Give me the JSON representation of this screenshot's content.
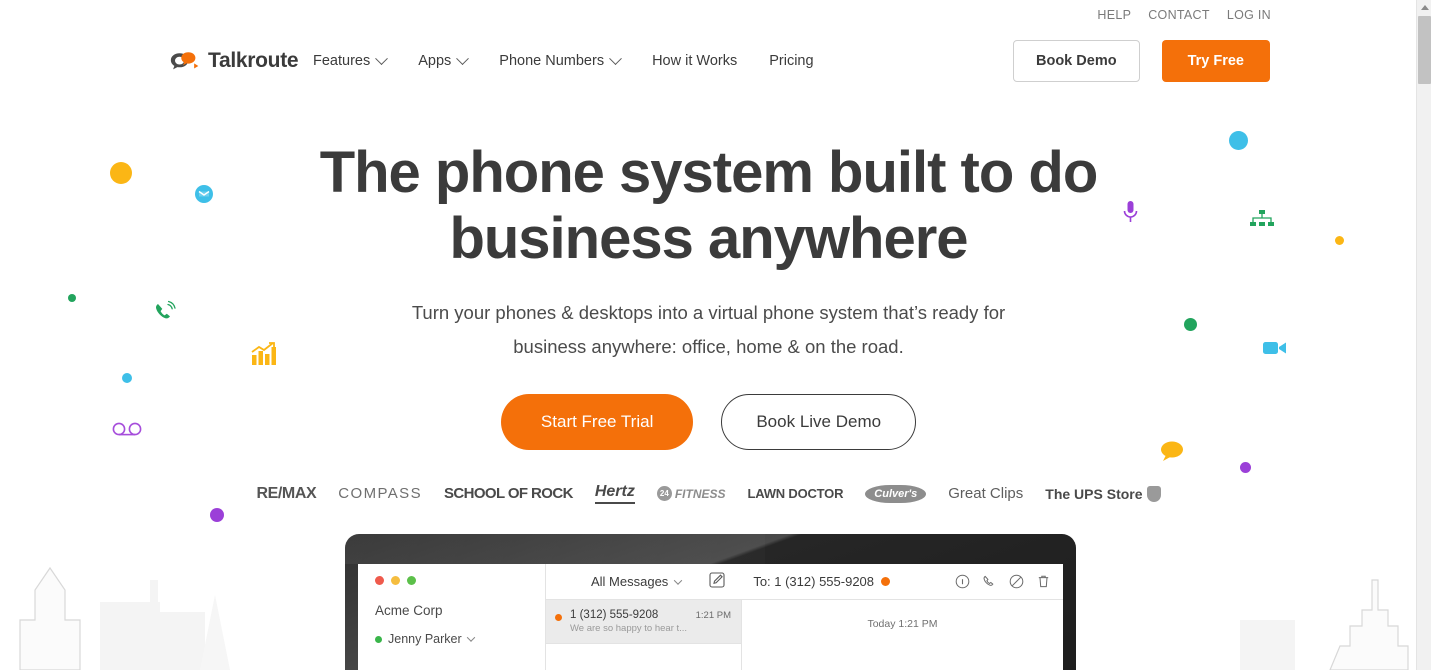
{
  "utility_nav": [
    {
      "label": "HELP"
    },
    {
      "label": "CONTACT"
    },
    {
      "label": "LOG IN"
    }
  ],
  "brand": {
    "name": "Talkroute",
    "logo_icon": "talkroute-logo-icon"
  },
  "nav": [
    {
      "label": "Features",
      "has_dropdown": true
    },
    {
      "label": "Apps",
      "has_dropdown": true
    },
    {
      "label": "Phone Numbers",
      "has_dropdown": true
    },
    {
      "label": "How it Works",
      "has_dropdown": false
    },
    {
      "label": "Pricing",
      "has_dropdown": false
    }
  ],
  "header_ctas": {
    "demo_label": "Book Demo",
    "try_label": "Try Free"
  },
  "hero": {
    "headline": "The phone system built to do business anywhere",
    "subhead": "Turn your phones & desktops into a virtual phone system that’s ready for business anywhere: office, home & on the road.",
    "primary_cta": "Start Free Trial",
    "secondary_cta": "Book Live Demo"
  },
  "client_logos": [
    {
      "name": "RE/MAX"
    },
    {
      "name": "COMPASS"
    },
    {
      "name": "SCHOOL OF ROCK"
    },
    {
      "name": "Hertz"
    },
    {
      "name": "FITNESS"
    },
    {
      "name": "LAWN DOCTOR"
    },
    {
      "name": "Culver's"
    },
    {
      "name": "Great Clips"
    },
    {
      "name": "The UPS Store"
    }
  ],
  "decorations": [
    {
      "icon": "yellow-dot-icon",
      "color": "#fbb615"
    },
    {
      "icon": "blue-envelope-icon",
      "color": "#3ebfe8"
    },
    {
      "icon": "green-dot-icon",
      "color": "#22a45d"
    },
    {
      "icon": "green-ringing-phone-icon",
      "color": "#22a45d"
    },
    {
      "icon": "orange-bar-chart-icon",
      "color": "#fbb615"
    },
    {
      "icon": "blue-dot-icon",
      "color": "#3ebfe8"
    },
    {
      "icon": "purple-voicemail-icon",
      "color": "#a64ddb"
    },
    {
      "icon": "purple-dot-icon",
      "color": "#9b3fd8"
    },
    {
      "icon": "blue-dot-icon",
      "color": "#3ebfe8"
    },
    {
      "icon": "purple-microphone-icon",
      "color": "#9b3fd8"
    },
    {
      "icon": "green-sitemap-icon",
      "color": "#22a45d"
    },
    {
      "icon": "yellow-dot-icon",
      "color": "#fbb615"
    },
    {
      "icon": "green-dot-icon",
      "color": "#22a45d"
    },
    {
      "icon": "blue-video-camera-icon",
      "color": "#3ebfe8"
    },
    {
      "icon": "yellow-chat-bubble-icon",
      "color": "#fbb615"
    },
    {
      "icon": "purple-dot-icon",
      "color": "#9b3fd8"
    }
  ],
  "app_mockup": {
    "sidebar": {
      "org_name": "Acme Corp",
      "user_name": "Jenny Parker"
    },
    "toolbar": {
      "filter_label": "All Messages",
      "compose_icon": "compose-pencil-icon",
      "to_label": "To: 1 (312) 555-9208",
      "icons": [
        {
          "name": "info-icon"
        },
        {
          "name": "phone-icon"
        },
        {
          "name": "block-icon"
        },
        {
          "name": "trash-icon"
        }
      ]
    },
    "messages": [
      {
        "number": "1 (312) 555-9208",
        "time": "1:21 PM",
        "preview": "We are so happy to hear t...",
        "unread": true,
        "selected": true
      }
    ],
    "thread": {
      "timestamp": "Today 1:21 PM"
    }
  },
  "colors": {
    "accent_orange": "#f4700a",
    "text_dark": "#3b3b3b",
    "muted": "#7a7a7a"
  }
}
